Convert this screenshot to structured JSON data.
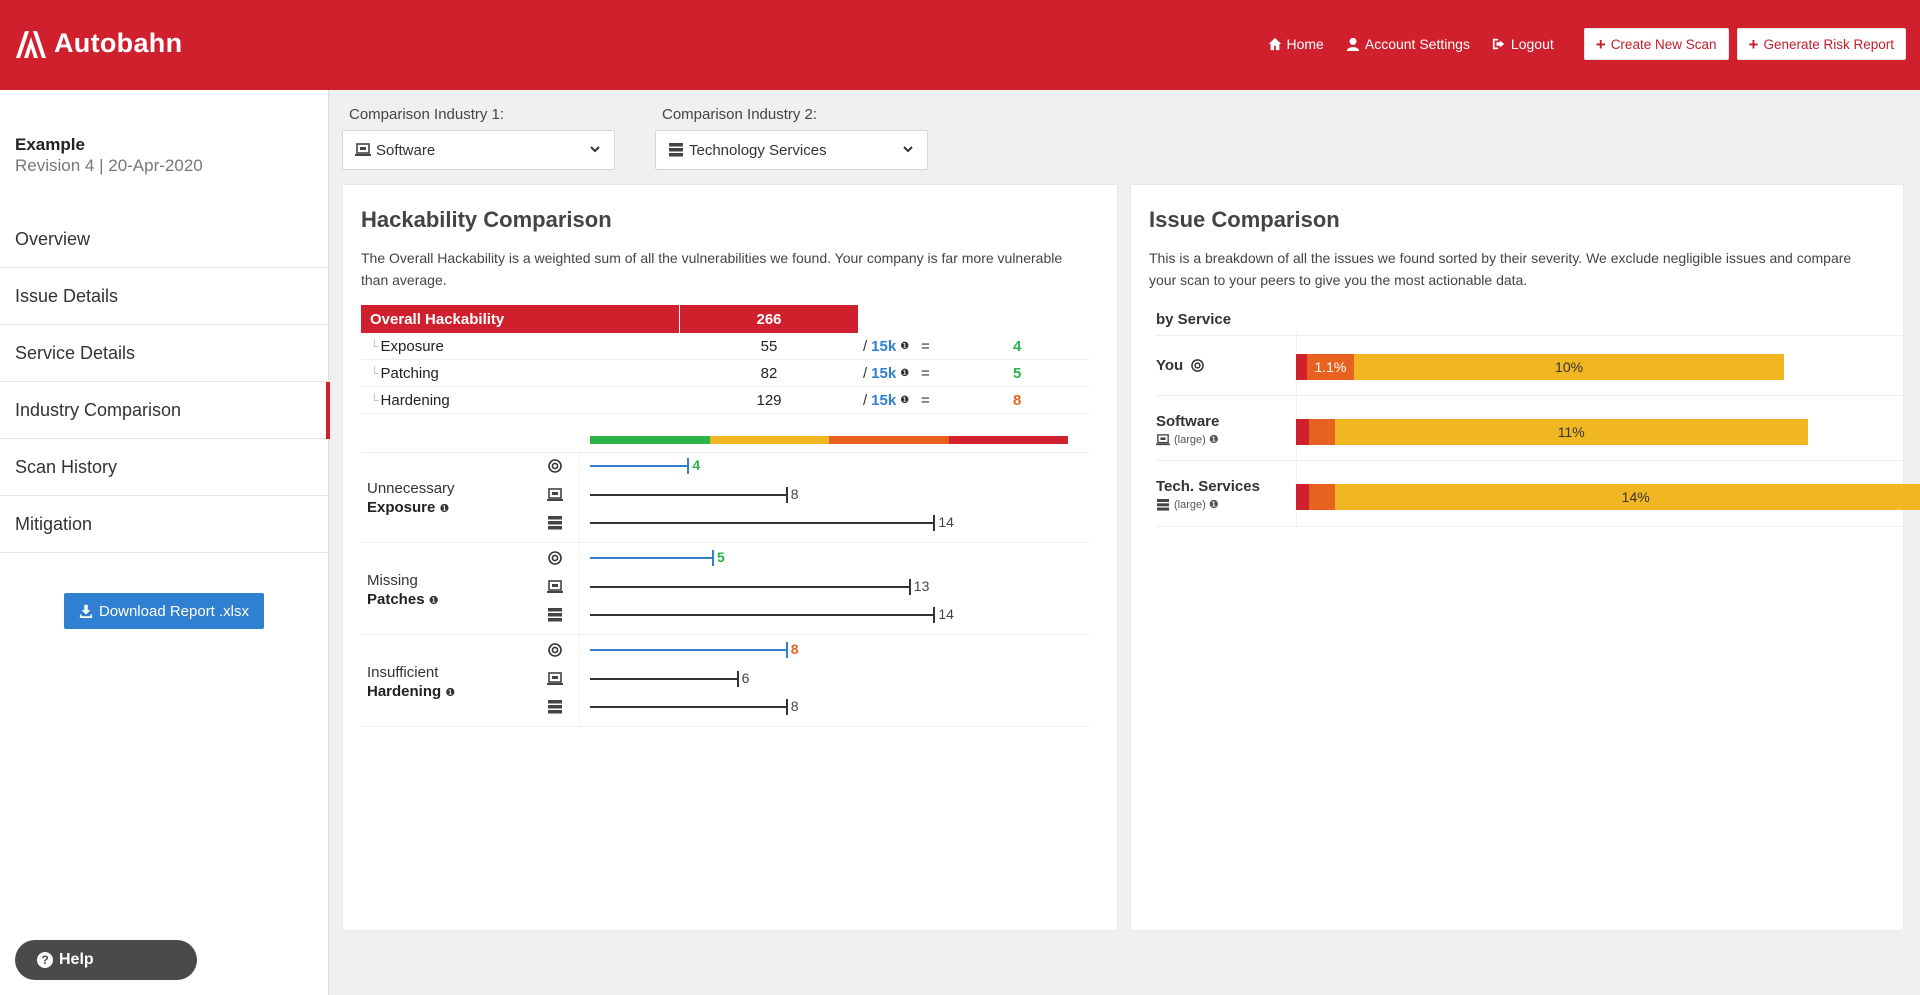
{
  "header": {
    "brand": "Autobahn",
    "nav": {
      "home": "Home",
      "account_settings": "Account Settings",
      "logout": "Logout",
      "create_new_scan": "Create New Scan",
      "generate_risk_report": "Generate Risk Report"
    }
  },
  "sidebar": {
    "scan_name": "Example",
    "revision": "Revision 4 | 20-Apr-2020",
    "items": [
      {
        "label": "Overview"
      },
      {
        "label": "Issue Details"
      },
      {
        "label": "Service Details"
      },
      {
        "label": "Industry Comparison"
      },
      {
        "label": "Scan History"
      },
      {
        "label": "Mitigation"
      }
    ],
    "download_label": "Download Report .xlsx",
    "help_label": "Help"
  },
  "comparison": {
    "industry1_label": "Comparison Industry 1:",
    "industry1_value": "Software",
    "industry2_label": "Comparison Industry 2:",
    "industry2_value": "Technology Services"
  },
  "hackability": {
    "title": "Hackability Comparison",
    "description": "The Overall Hackability is a weighted sum of all the vulnerabilities we found. Your company is far more vulnerable than average.",
    "header_label": "Overall Hackability",
    "header_value": "266",
    "rows": [
      {
        "name": "Exposure",
        "value": "55",
        "slash": "/",
        "denom": "15k",
        "eq": "=",
        "score": "4"
      },
      {
        "name": "Patching",
        "value": "82",
        "slash": "/",
        "denom": "15k",
        "eq": "=",
        "score": "5"
      },
      {
        "name": "Hardening",
        "value": "129",
        "slash": "/",
        "denom": "15k",
        "eq": "=",
        "score": "8"
      }
    ],
    "scale_colors": [
      "#2db34a",
      "#f0b722",
      "#e8621f",
      "#d0202e"
    ],
    "groups": [
      {
        "line1": "Unnecessary",
        "line2": "Exposure",
        "you": 4,
        "software": 8,
        "tech": 14
      },
      {
        "line1": "Missing",
        "line2": "Patches",
        "you": 5,
        "software": 13,
        "tech": 14
      },
      {
        "line1": "Insufficient",
        "line2": "Hardening",
        "you": 8,
        "software": 6,
        "tech": 8
      }
    ]
  },
  "issues": {
    "title": "Issue Comparison",
    "description": "This is a breakdown of all the issues we found sorted by their severity. We exclude negligible issues and compare your scan to your peers to give you the most actionable data.",
    "by_service_label": "by Service",
    "services": [
      {
        "name": "You",
        "sub": "",
        "critical_pct": 0.25,
        "high_pct": 1.1,
        "medium_pct": 10,
        "high_label": "1.1%",
        "medium_label": "10%"
      },
      {
        "name": "Software",
        "sub": "(large)",
        "critical_pct": 0.3,
        "high_pct": 0.6,
        "medium_pct": 11,
        "high_label": "",
        "medium_label": "11%"
      },
      {
        "name": "Tech. Services",
        "sub": "(large)",
        "critical_pct": 0.3,
        "high_pct": 0.6,
        "medium_pct": 14,
        "high_label": "",
        "medium_label": "14%"
      }
    ],
    "colors": {
      "critical": "#d0202e",
      "high": "#e8621f",
      "medium": "#f0b722"
    }
  }
}
